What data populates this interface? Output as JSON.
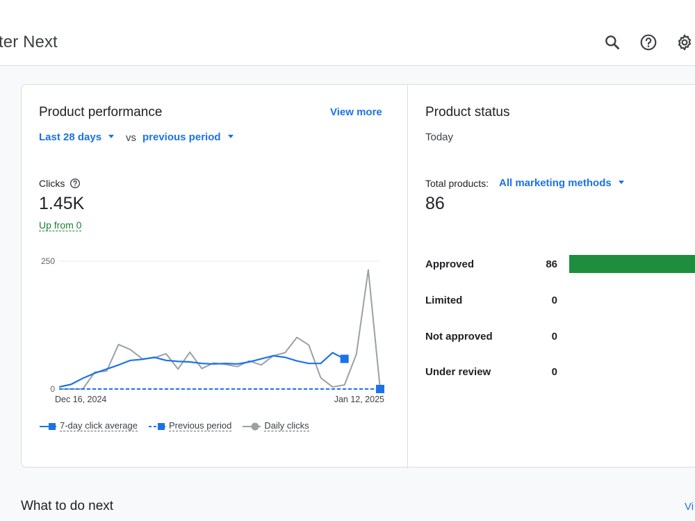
{
  "header": {
    "title": "ter Next",
    "icons": [
      "search-icon",
      "help-icon",
      "settings-icon"
    ]
  },
  "performance": {
    "title": "Product performance",
    "view_more": "View more",
    "period": "Last 28 days",
    "vs": "vs",
    "comparison": "previous period",
    "metric_label": "Clicks",
    "metric_value": "1.45K",
    "delta": "Up from 0"
  },
  "chart_data": {
    "type": "line",
    "ylim": [
      0,
      250
    ],
    "yticks": [
      "250",
      "0"
    ],
    "x_start_label": "Dec 16, 2024",
    "x_end_label": "Jan 12, 2025",
    "grid": true,
    "legend_position": "bottom",
    "colors": {
      "avg": "#1a73e8",
      "prev": "#1a73e8",
      "daily": "#9aa0a6"
    },
    "series": [
      {
        "name": "7-day click average",
        "values": [
          4,
          9,
          21,
          31,
          39,
          47,
          56,
          58,
          62,
          56,
          54,
          53,
          50,
          49,
          50,
          49,
          53,
          59,
          65,
          62,
          55,
          50,
          50,
          71,
          59
        ]
      },
      {
        "name": "Previous period",
        "values": [
          0,
          0,
          0,
          0,
          0,
          0,
          0,
          0,
          0,
          0,
          0,
          0,
          0,
          0,
          0,
          0,
          0,
          0,
          0,
          0,
          0,
          0,
          0,
          0,
          0,
          0,
          0,
          0
        ]
      },
      {
        "name": "Daily clicks",
        "values": [
          0,
          0,
          0,
          33,
          35,
          87,
          77,
          59,
          61,
          69,
          39,
          72,
          40,
          51,
          48,
          44,
          55,
          47,
          65,
          71,
          101,
          86,
          22,
          4,
          8,
          68,
          233,
          0
        ]
      }
    ]
  },
  "status": {
    "title": "Product status",
    "date": "Today",
    "total_label": "Total products:",
    "filter": "All marketing methods",
    "total_value": "86",
    "rows": [
      {
        "label": "Approved",
        "count": "86",
        "fraction": 1.0
      },
      {
        "label": "Limited",
        "count": "0",
        "fraction": 0
      },
      {
        "label": "Not approved",
        "count": "0",
        "fraction": 0
      },
      {
        "label": "Under review",
        "count": "0",
        "fraction": 0
      }
    ],
    "bar_color": "#1e8e3e"
  },
  "next": {
    "title": "What to do next",
    "link": "Vi"
  }
}
